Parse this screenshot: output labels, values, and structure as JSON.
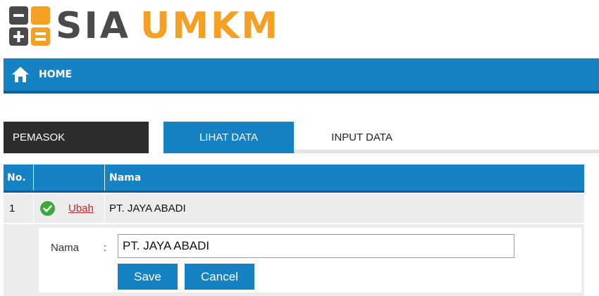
{
  "brand": {
    "name_part1": "SIA",
    "name_part2": "UMKM",
    "icon": "calculator-icon",
    "colors": {
      "dark": "#4a4a4a",
      "orange": "#f3a024"
    }
  },
  "nav": {
    "home_label": "HOME",
    "home_icon": "home-icon",
    "bar_color": "#1482c3"
  },
  "section": {
    "title": "PEMASOK",
    "tabs": [
      {
        "label": "LIHAT DATA",
        "active": true
      },
      {
        "label": "INPUT DATA",
        "active": false
      }
    ]
  },
  "table": {
    "header_color": "#1482c3",
    "columns": [
      "No.",
      "",
      "Nama"
    ],
    "rows": [
      {
        "no": "1",
        "status_icon": "check-circle-icon",
        "action": "Ubah",
        "nama": "PT. JAYA ABADI"
      }
    ]
  },
  "edit_form": {
    "field_label": "Nama",
    "separator": ":",
    "field_value": "PT. JAYA ABADI",
    "save_label": "Save",
    "cancel_label": "Cancel",
    "button_color": "#1482c3"
  }
}
